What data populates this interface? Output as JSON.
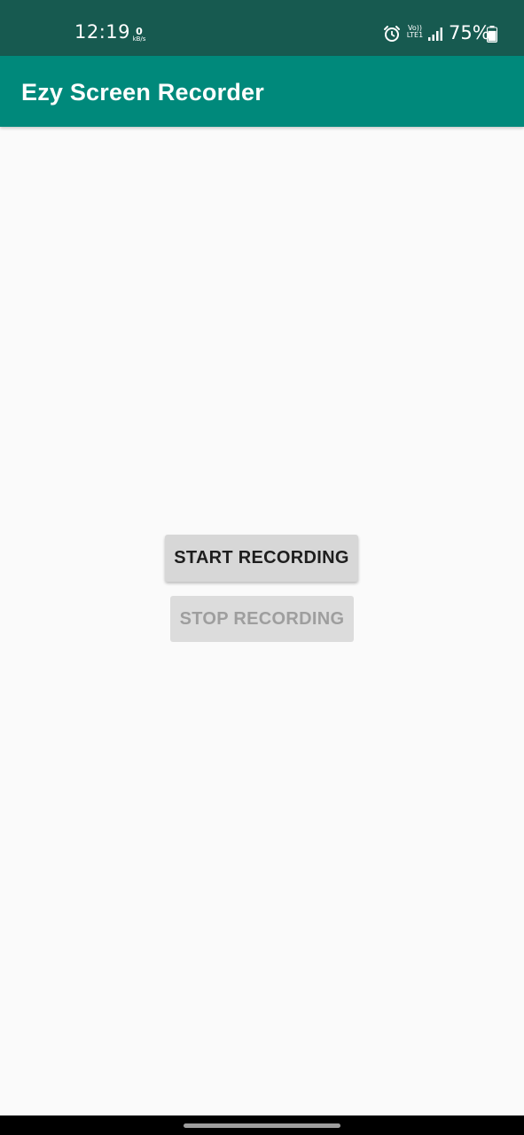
{
  "status_bar": {
    "time": "12:19",
    "net_speed_value": "0",
    "net_speed_unit": "kB/s",
    "volte_top": "Vo))",
    "volte_bottom": "LTE1",
    "battery_percent": "75%",
    "icons": [
      "alarm-icon",
      "volte-icon",
      "signal-icon",
      "battery-icon"
    ],
    "battery_level": 0.75
  },
  "app_bar": {
    "title": "Ezy Screen Recorder",
    "color": "#00897b"
  },
  "main": {
    "start_button_label": "START RECORDING",
    "stop_button_label": "STOP RECORDING",
    "stop_button_enabled": false
  },
  "colors": {
    "status_bar": "#175a50",
    "primary": "#00897b",
    "background": "#fafafa"
  }
}
